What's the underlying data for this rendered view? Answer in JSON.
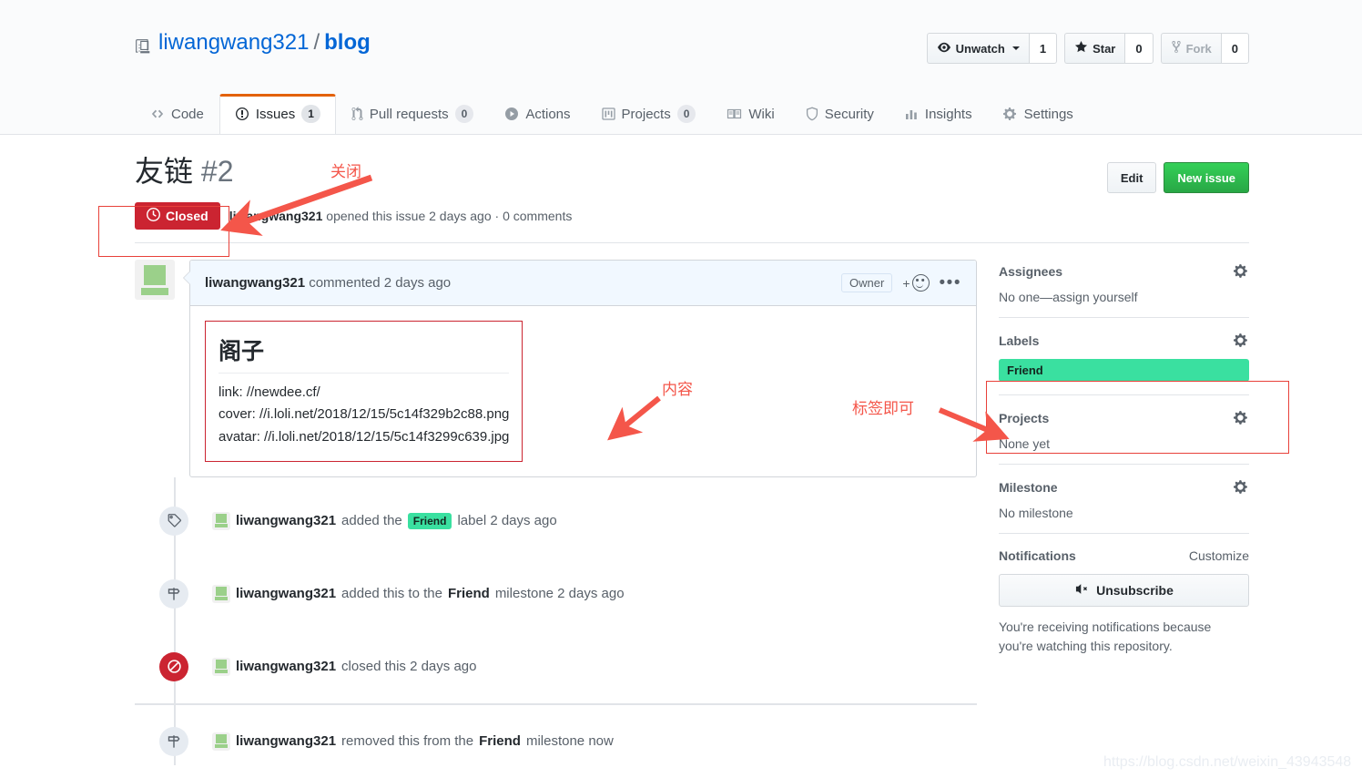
{
  "repo": {
    "icon": "repo-icon",
    "owner": "liwangwang321",
    "separator": "/",
    "name": "blog"
  },
  "header_buttons": [
    {
      "label": "Unwatch",
      "count": "1",
      "icon": "eye-icon",
      "has_caret": true,
      "disabled": false
    },
    {
      "label": "Star",
      "count": "0",
      "icon": "star-icon",
      "has_caret": false,
      "disabled": false
    },
    {
      "label": "Fork",
      "count": "0",
      "icon": "fork-icon",
      "has_caret": false,
      "disabled": true
    }
  ],
  "nav_tabs": [
    {
      "label": "Code",
      "count": "",
      "icon": "code-icon",
      "selected": false
    },
    {
      "label": "Issues",
      "count": "1",
      "icon": "issue-opened-icon",
      "selected": true
    },
    {
      "label": "Pull requests",
      "count": "0",
      "icon": "git-pull-request-icon",
      "selected": false
    },
    {
      "label": "Actions",
      "count": "",
      "icon": "play-icon",
      "selected": false
    },
    {
      "label": "Projects",
      "count": "0",
      "icon": "project-icon",
      "selected": false
    },
    {
      "label": "Wiki",
      "count": "",
      "icon": "book-icon",
      "selected": false
    },
    {
      "label": "Security",
      "count": "",
      "icon": "shield-icon",
      "selected": false
    },
    {
      "label": "Insights",
      "count": "",
      "icon": "graph-icon",
      "selected": false
    },
    {
      "label": "Settings",
      "count": "",
      "icon": "gear-icon",
      "selected": false
    }
  ],
  "issue": {
    "title": "友链",
    "number": "#2",
    "edit_label": "Edit",
    "new_issue_label": "New issue",
    "state_label": "Closed",
    "state_icon": "issue-closed-icon",
    "state_color": "#cb2431",
    "author": "liwangwang321",
    "meta_opened": "opened this issue 2 days ago",
    "meta_comments": "· 0 comments"
  },
  "comment": {
    "author": "liwangwang321",
    "action": "commented 2 days ago",
    "owner_tag": "Owner",
    "emoji_icon": "add-reaction-icon",
    "kebab_icon": "kebab-horizontal-icon",
    "heading": "阁子",
    "lines": [
      "link: //newdee.cf/",
      "cover: //i.loli.net/2018/12/15/5c14f329b2c88.png",
      "avatar: //i.loli.net/2018/12/15/5c14f3299c639.jpg"
    ]
  },
  "timeline": [
    {
      "icon": "tag-icon",
      "actor": "liwangwang321",
      "text_before": "added the",
      "chip": "Friend",
      "text_after": "label 2 days ago",
      "bold_term": "",
      "kind": "label"
    },
    {
      "icon": "milestone-icon",
      "actor": "liwangwang321",
      "text_before": "added this to the",
      "chip": "",
      "bold_term": "Friend",
      "text_after": "milestone 2 days ago",
      "kind": "milestone"
    },
    {
      "icon": "circle-slash-icon",
      "actor": "liwangwang321",
      "text_before": "closed this 2 days ago",
      "chip": "",
      "bold_term": "",
      "text_after": "",
      "kind": "closed"
    },
    {
      "icon": "milestone-icon",
      "actor": "liwangwang321",
      "text_before": "removed this from the",
      "chip": "",
      "bold_term": "Friend",
      "text_after": "milestone now",
      "kind": "milestone"
    }
  ],
  "sidebar": {
    "assignees": {
      "title": "Assignees",
      "value": "No one—assign yourself",
      "gear": "gear-icon"
    },
    "labels": {
      "title": "Labels",
      "chip": "Friend",
      "chip_color": "#3ae0a0",
      "gear": "gear-icon"
    },
    "projects": {
      "title": "Projects",
      "value": "None yet",
      "gear": "gear-icon"
    },
    "milestone": {
      "title": "Milestone",
      "value": "No milestone",
      "gear": "gear-icon"
    },
    "notifications": {
      "title": "Notifications",
      "customize": "Customize",
      "button_label": "Unsubscribe",
      "button_icon": "mute-icon",
      "note_line1": "You're receiving notifications because",
      "note_line2": "you're watching this repository."
    }
  },
  "annotations": [
    {
      "text": "关闭",
      "name": "annotation-close"
    },
    {
      "text": "内容",
      "name": "annotation-content"
    },
    {
      "text": "标签即可",
      "name": "annotation-label"
    }
  ],
  "watermark": "https://blog.csdn.net/weixin_43943548"
}
